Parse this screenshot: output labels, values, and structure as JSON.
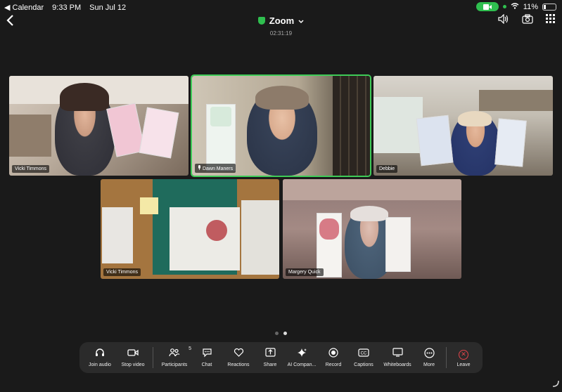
{
  "status_bar": {
    "back_app": "◀ Calendar",
    "time": "9:33 PM",
    "date": "Sun Jul 12",
    "battery": "11%"
  },
  "header": {
    "title": "Zoom",
    "timer": "02:31:19"
  },
  "tiles": [
    {
      "name": "Vicki Timmons"
    },
    {
      "name": "Dawn Maners"
    },
    {
      "name": "Debbie"
    },
    {
      "name": "Vicki Timmons"
    },
    {
      "name": "Margery Quick"
    }
  ],
  "toolbar": {
    "join_audio": "Join audio",
    "stop_video": "Stop video",
    "participants": "Participants",
    "participants_count": "5",
    "chat": "Chat",
    "reactions": "Reactions",
    "share": "Share",
    "ai_companion": "AI Compan...",
    "record": "Record",
    "captions": "Captions",
    "whiteboards": "Whiteboards",
    "more": "More",
    "leave": "Leave"
  },
  "colors": {
    "accent_green": "#3ecb57",
    "leave_red": "#e0444a"
  }
}
